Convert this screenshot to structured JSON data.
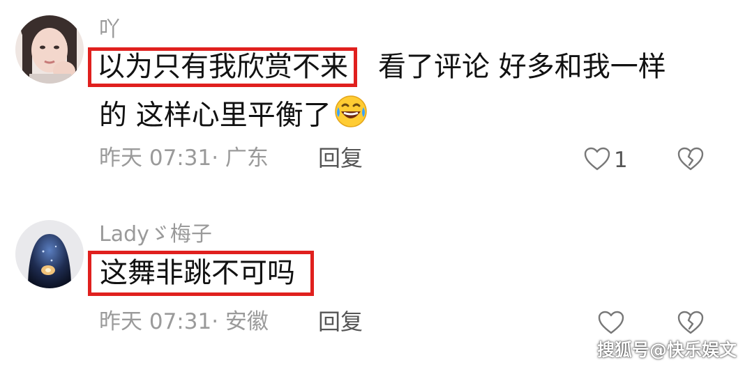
{
  "comments": [
    {
      "username": "吖",
      "highlighted_text": "以为只有我欣赏不来",
      "text_rest_line1": "看了评论 好多和我一样",
      "text_line2": "的 这样心里平衡了",
      "emoji": "laughing-tears-emoji",
      "meta": "昨天 07:31· 广东",
      "reply_label": "回复",
      "like_count": "1"
    },
    {
      "username": "Ladyゞ梅子",
      "highlighted_text": "这舞非跳不可吗",
      "meta": "昨天 07:31· 安徽",
      "reply_label": "回复",
      "like_count": ""
    }
  ],
  "watermark": "搜狐号@快乐娱文",
  "colors": {
    "highlight_border": "#e0201e",
    "meta_text": "#9a9a9a",
    "body_text": "#111111",
    "icon_stroke": "#777777"
  }
}
